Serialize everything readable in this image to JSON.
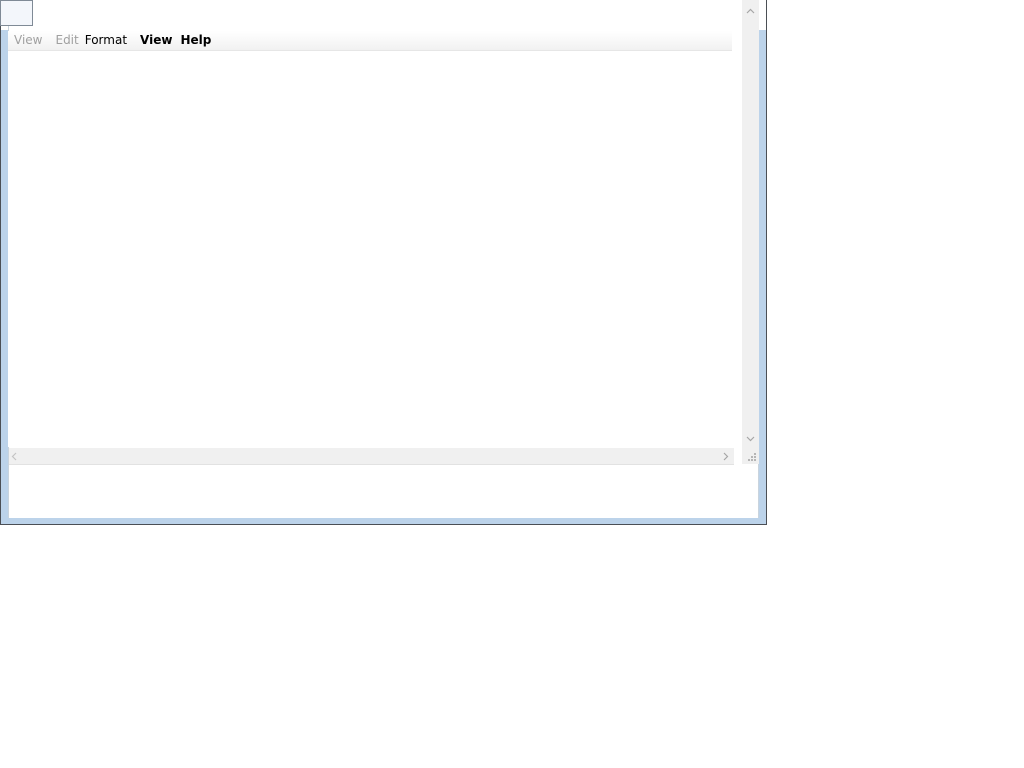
{
  "window": {
    "frame_color": "#bcd3ea",
    "border_color": "#4b4f55"
  },
  "menu": {
    "items": [
      {
        "label": "View",
        "state": "disabled"
      },
      {
        "label": "Edit",
        "state": "disabled"
      },
      {
        "label": "Format",
        "state": "normal"
      },
      {
        "label": "View",
        "state": "bold"
      },
      {
        "label": "Help",
        "state": "bold"
      }
    ]
  },
  "editor": {
    "text": ""
  },
  "icons": {
    "scroll_up": "chevron-up-icon",
    "scroll_down": "chevron-down-icon",
    "scroll_left": "chevron-left-icon",
    "scroll_right": "chevron-right-icon",
    "size_grip": "resize-grip-icon"
  }
}
